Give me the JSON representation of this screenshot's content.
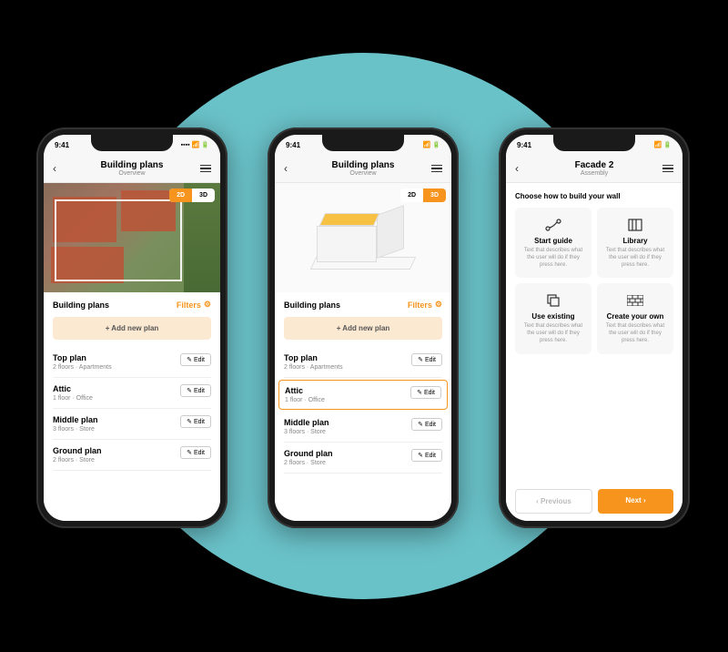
{
  "status": {
    "time": "9:41",
    "signal": "▪▪▪▪",
    "wifi": "◉",
    "battery": "▮"
  },
  "phone1": {
    "title": "Building plans",
    "subtitle": "Overview",
    "toggle": {
      "opt2d": "2D",
      "opt3d": "3D"
    },
    "section_title": "Building plans",
    "filters_label": "Filters",
    "add_plan": "+  Add new plan",
    "edit_label": "Edit",
    "plans": [
      {
        "name": "Top plan",
        "meta": "2 floors  ·  Apartments"
      },
      {
        "name": "Attic",
        "meta": "1 floor  ·  Office"
      },
      {
        "name": "Middle plan",
        "meta": "3 floors  ·  Store"
      },
      {
        "name": "Ground plan",
        "meta": "2 floors  ·  Store"
      }
    ]
  },
  "phone2": {
    "title": "Building plans",
    "subtitle": "Overview",
    "toggle": {
      "opt2d": "2D",
      "opt3d": "3D"
    },
    "section_title": "Building plans",
    "filters_label": "Filters",
    "add_plan": "+  Add new plan",
    "edit_label": "Edit",
    "plans": [
      {
        "name": "Top plan",
        "meta": "2 floors  ·  Apartments"
      },
      {
        "name": "Attic",
        "meta": "1 floor  ·  Office"
      },
      {
        "name": "Middle plan",
        "meta": "3 floors  ·  Store"
      },
      {
        "name": "Ground plan",
        "meta": "2 floors  ·  Store"
      }
    ]
  },
  "phone3": {
    "title": "Facade 2",
    "subtitle": "Assembly",
    "choose": "Choose how to build your wall",
    "options": [
      {
        "title": "Start guide",
        "desc": "Text that describes what the user will do if they press here."
      },
      {
        "title": "Library",
        "desc": "Text that describes what the user will do if they press here."
      },
      {
        "title": "Use existing",
        "desc": "Text that describes what the user will do if they press here."
      },
      {
        "title": "Create your own",
        "desc": "Text that describes what the user will do if they press here."
      }
    ],
    "prev": "Previous",
    "next": "Next"
  }
}
